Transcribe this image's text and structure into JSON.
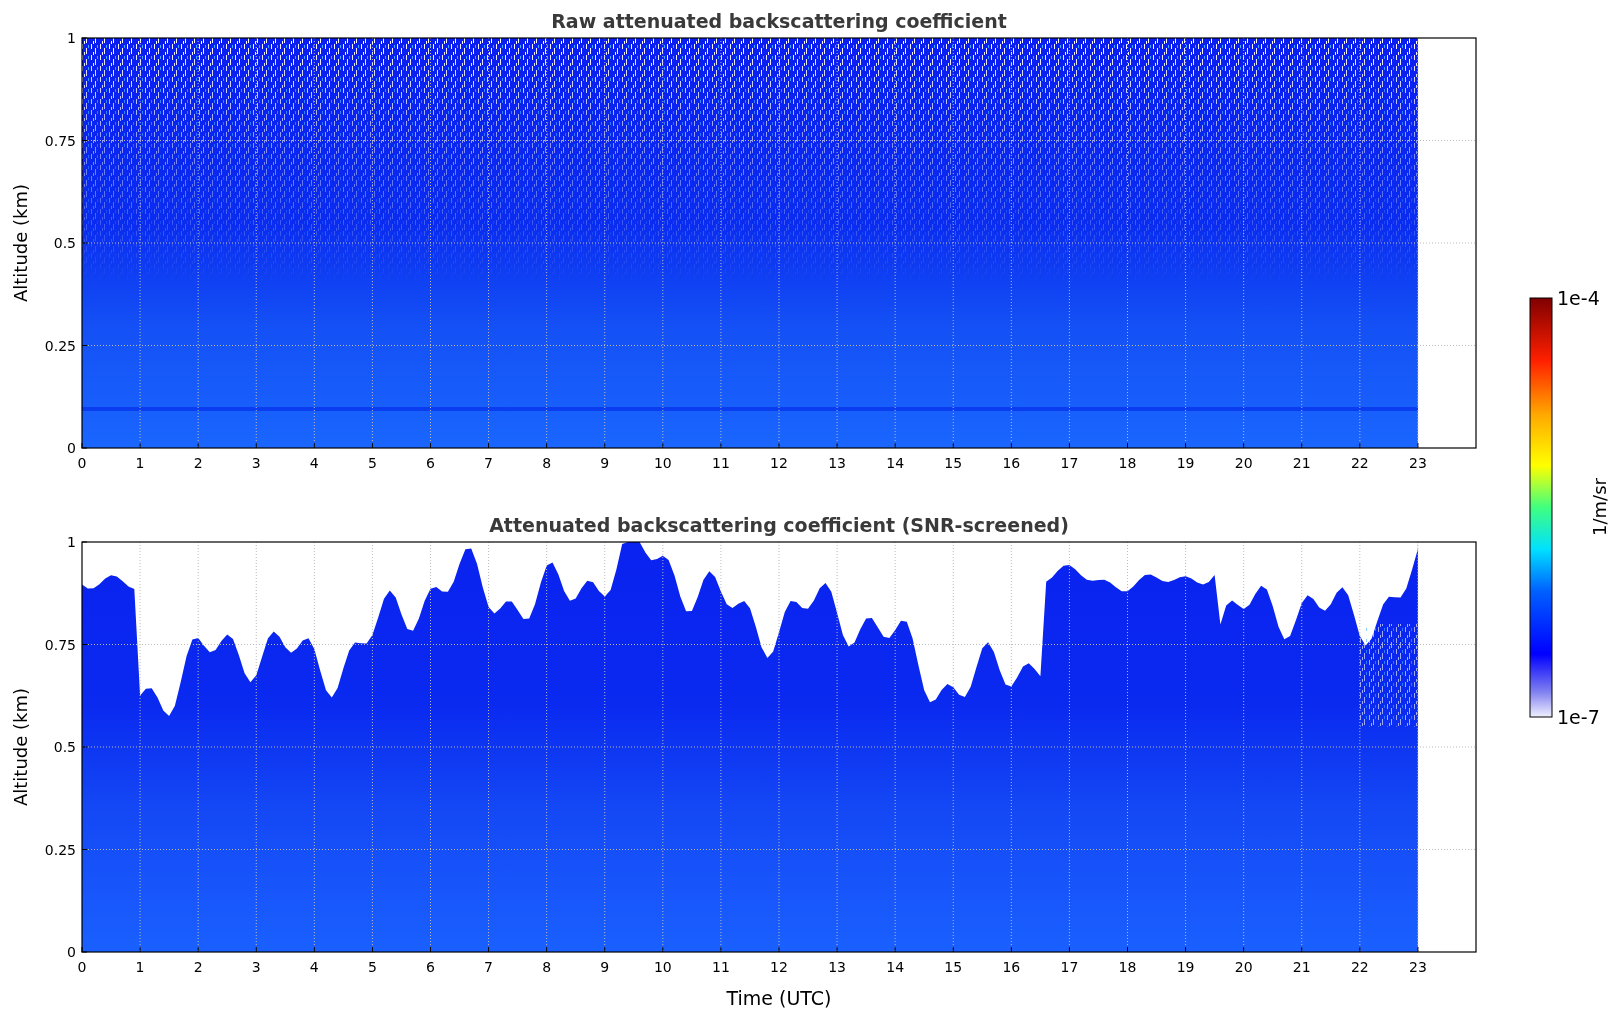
{
  "plots": [
    {
      "kind": "raw",
      "title": "Raw attenuated backscattering coefficient",
      "ylabel": "Altitude (km)",
      "yticks": [
        "1",
        "0.75",
        "0.5",
        "0.25",
        "0"
      ],
      "xticks": [
        "0",
        "1",
        "2",
        "3",
        "4",
        "5",
        "6",
        "7",
        "8",
        "9",
        "10",
        "11",
        "12",
        "13",
        "14",
        "15",
        "16",
        "17",
        "18",
        "19",
        "20",
        "21",
        "22",
        "23"
      ]
    },
    {
      "kind": "screened",
      "title": "Attenuated backscattering coefficient (SNR-screened)",
      "ylabel": "Altitude (km)",
      "yticks": [
        "1",
        "0.75",
        "0.5",
        "0.25",
        "0"
      ],
      "xticks": [
        "0",
        "1",
        "2",
        "3",
        "4",
        "5",
        "6",
        "7",
        "8",
        "9",
        "10",
        "11",
        "12",
        "13",
        "14",
        "15",
        "16",
        "17",
        "18",
        "19",
        "20",
        "21",
        "22",
        "23"
      ],
      "xlabel": "Time (UTC)"
    }
  ],
  "colorbar": {
    "max_label": "1e-4",
    "min_label": "1e-7",
    "label": "1/m/sr"
  }
}
